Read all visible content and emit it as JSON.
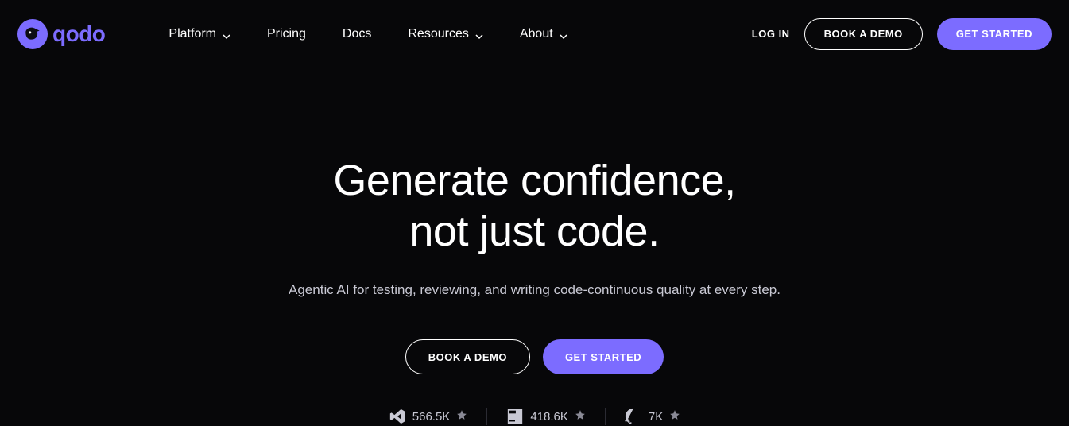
{
  "brand": {
    "name": "qodo"
  },
  "nav": {
    "items": [
      {
        "label": "Platform",
        "has_submenu": true
      },
      {
        "label": "Pricing",
        "has_submenu": false
      },
      {
        "label": "Docs",
        "has_submenu": false
      },
      {
        "label": "Resources",
        "has_submenu": true
      },
      {
        "label": "About",
        "has_submenu": true
      }
    ]
  },
  "header_actions": {
    "login": "LOG IN",
    "book_demo": "BOOK A DEMO",
    "get_started": "GET STARTED"
  },
  "hero": {
    "headline_line1": "Generate confidence,",
    "headline_line2": "not just code.",
    "subtitle": "Agentic AI for testing, reviewing, and writing code-continuous quality at every step.",
    "book_demo": "BOOK A DEMO",
    "get_started": "GET STARTED"
  },
  "stats": [
    {
      "icon": "vscode-icon",
      "value": "566.5K"
    },
    {
      "icon": "jetbrains-icon",
      "value": "418.6K"
    },
    {
      "icon": "github-icon",
      "value": "7K"
    }
  ],
  "colors": {
    "accent": "#7c6cff",
    "bg": "#070709"
  }
}
